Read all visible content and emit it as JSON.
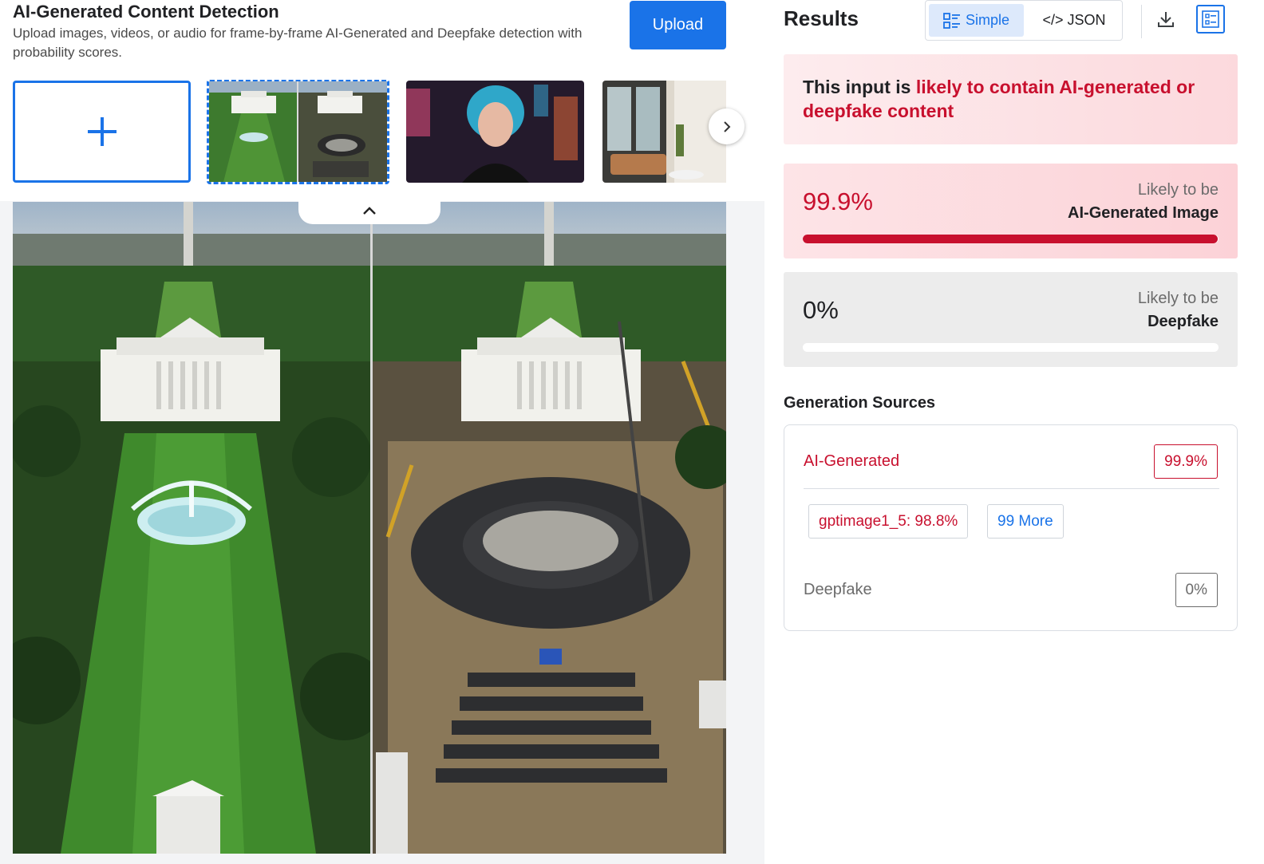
{
  "header": {
    "title": "AI-Generated Content Detection",
    "description": "Upload images, videos, or audio for frame-by-frame AI-Generated and Deepfake detection with probability scores.",
    "upload_label": "Upload"
  },
  "results": {
    "title": "Results",
    "view_toggle": {
      "simple_label": "Simple",
      "json_label": "</> JSON",
      "selected": "Simple"
    },
    "verdict": {
      "prefix": "This input is ",
      "highlight": "likely to contain AI-generated or deepfake content"
    },
    "scores": [
      {
        "value_text": "99.9%",
        "progress": 0.999,
        "line1": "Likely to be",
        "line2": "AI-Generated Image"
      },
      {
        "value_text": "0%",
        "progress": 0.0,
        "line1": "Likely to be",
        "line2": "Deepfake"
      }
    ],
    "generation_sources": {
      "title": "Generation Sources",
      "ai_label": "AI-Generated",
      "ai_score": "99.9%",
      "models": [
        {
          "label": "gptimage1_5: 98.8%"
        }
      ],
      "more_label": "99 More",
      "deepfake_label": "Deepfake",
      "deepfake_score": "0%"
    }
  },
  "colors": {
    "accent": "#1a73e8",
    "danger": "#c8102e",
    "neutral": "#6b6b6b"
  },
  "icons": {
    "add": "plus-icon",
    "next": "chevron-right-icon",
    "collapse": "chevron-up-icon",
    "simple": "list-icon",
    "download": "download-icon",
    "report": "report-icon"
  }
}
